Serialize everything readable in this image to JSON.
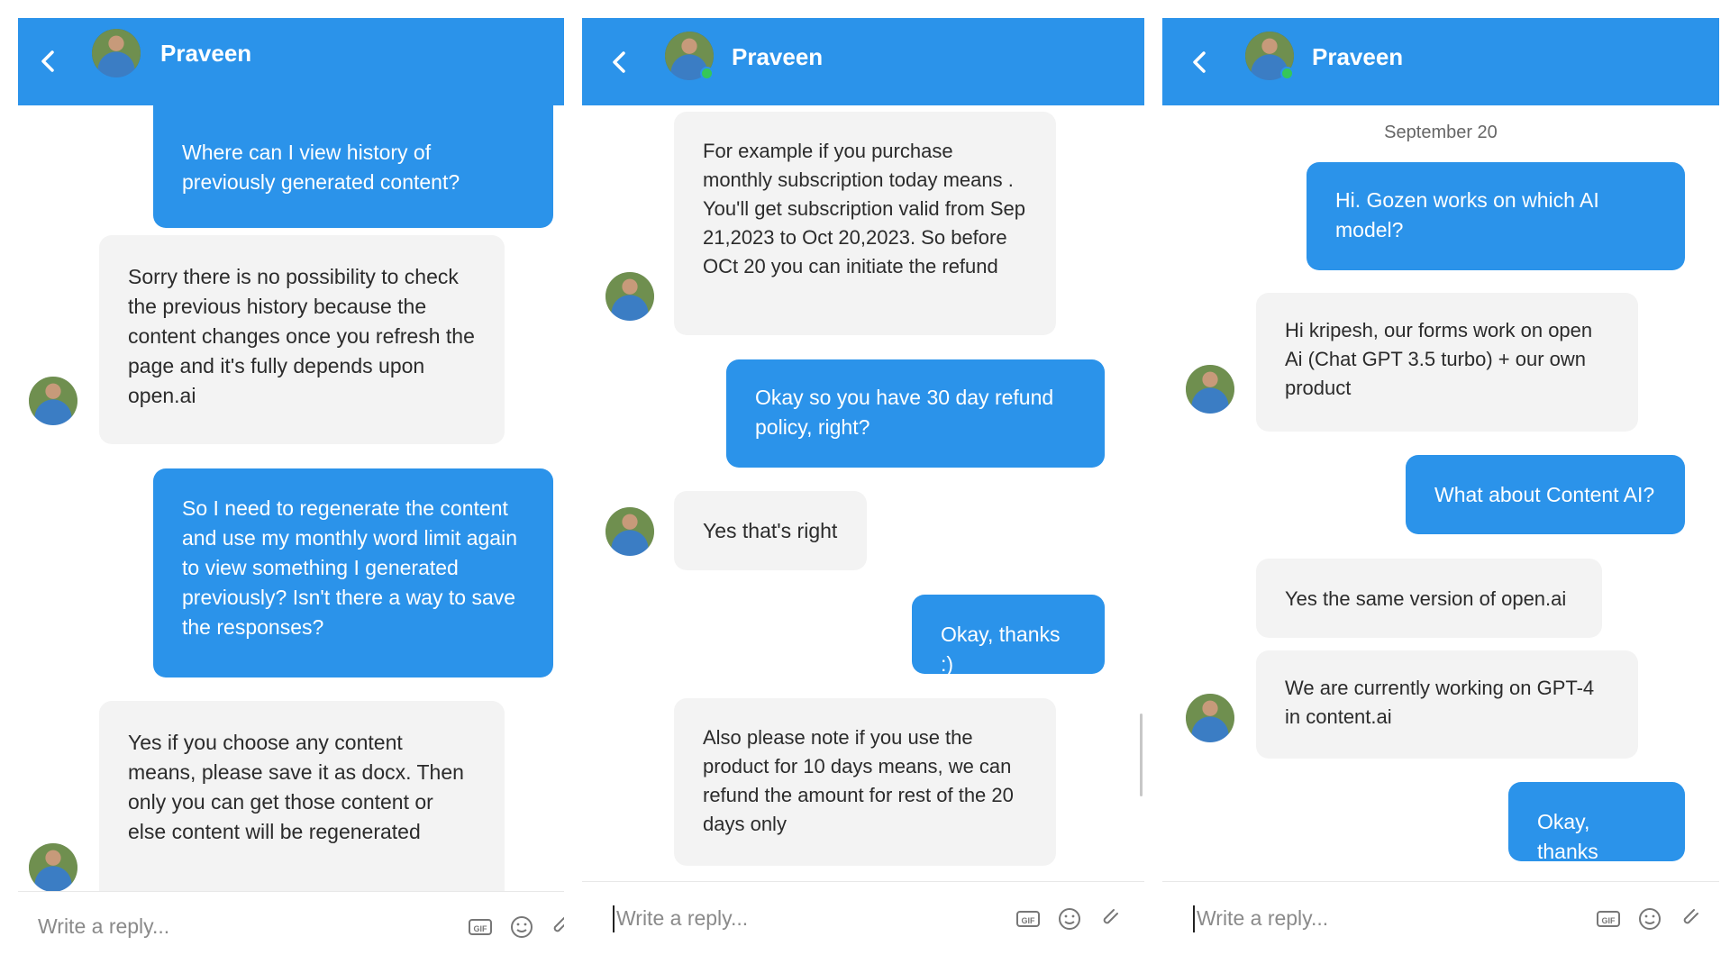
{
  "contact_name": "Praveen",
  "composer_placeholder": "Write a reply...",
  "colors": {
    "header": "#2b93ea",
    "user_bubble": "#2b93ea",
    "agent_bubble": "#f3f3f3",
    "online": "#35c759"
  },
  "icons": {
    "back": "chevron-left-icon",
    "gif": "gif-icon",
    "emoji": "smiley-icon",
    "attach": "paperclip-icon"
  },
  "panels": [
    {
      "messages": [
        {
          "from": "user",
          "text": "Where can I view history of previously generated content?"
        },
        {
          "from": "agent",
          "text": "Sorry there is no possibility to check the previous history because the content changes once you refresh the page and it's fully depends upon open.ai"
        },
        {
          "from": "user",
          "text": "So I need to regenerate the content and use my monthly word limit again to view something I generated previously? Isn't there a way to save the responses?"
        },
        {
          "from": "agent",
          "text": "Yes if you choose any content means, please save it as docx. Then only you can get those content or else content will be regenerated"
        }
      ]
    },
    {
      "messages": [
        {
          "from": "agent",
          "text": "For example if you purchase monthly subscription today means . You'll get subscription valid from Sep 21,2023 to Oct 20,2023. So before OCt 20 you can initiate the refund"
        },
        {
          "from": "user",
          "text": "Okay so you have 30 day refund policy, right?"
        },
        {
          "from": "agent",
          "text": "Yes that's right"
        },
        {
          "from": "user",
          "text": "Okay, thanks :)"
        },
        {
          "from": "agent",
          "text": "Also please note if you use the product for 10 days means, we can refund the amount for rest of the 20 days only"
        }
      ]
    },
    {
      "date": "September 20",
      "messages": [
        {
          "from": "user",
          "text": "Hi. Gozen works on which AI model?"
        },
        {
          "from": "agent",
          "text": "Hi kripesh, our forms work on open Ai (Chat GPT 3.5 turbo) + our own product"
        },
        {
          "from": "user",
          "text": "What about Content AI?"
        },
        {
          "from": "agent",
          "text": "Yes the same version of open.ai"
        },
        {
          "from": "agent",
          "text": "We are currently working on GPT-4 in content.ai"
        },
        {
          "from": "user",
          "text": "Okay, thanks"
        }
      ]
    }
  ]
}
